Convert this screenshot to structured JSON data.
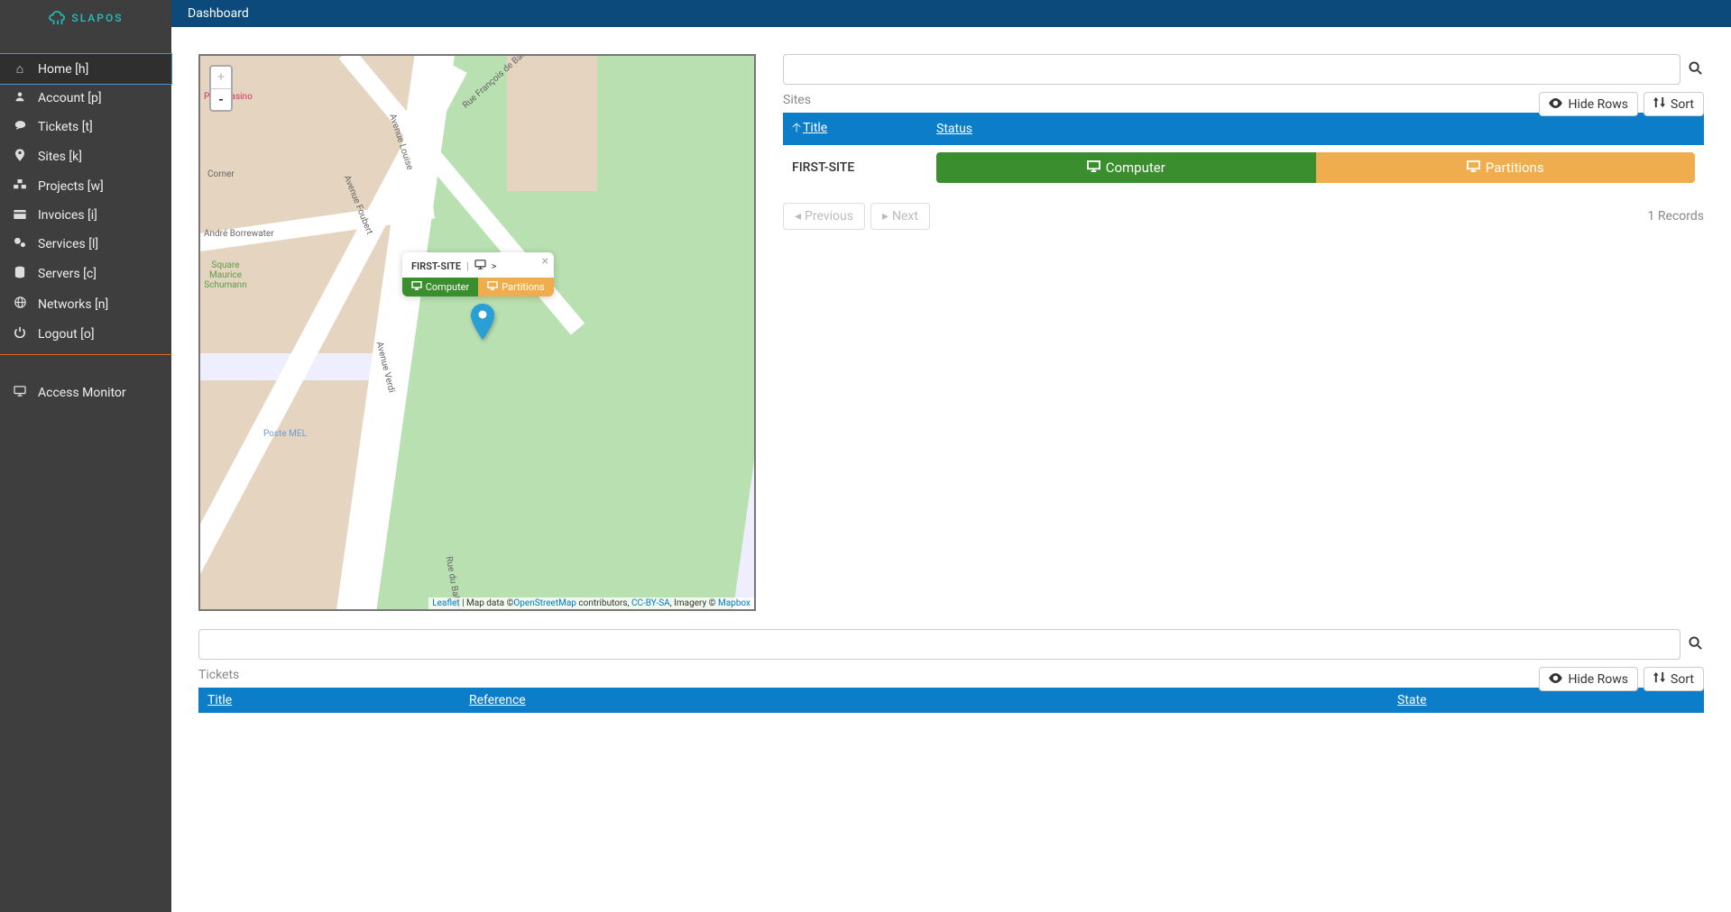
{
  "brand": "SLAPOS",
  "topbar": {
    "title": "Dashboard"
  },
  "sidebar": {
    "items": [
      {
        "icon": "home",
        "label": "Home [h]",
        "active": true
      },
      {
        "icon": "user",
        "label": "Account [p]"
      },
      {
        "icon": "chat",
        "label": "Tickets [t]"
      },
      {
        "icon": "pin",
        "label": "Sites [k]"
      },
      {
        "icon": "cubes",
        "label": "Projects [w]"
      },
      {
        "icon": "card",
        "label": "Invoices [i]"
      },
      {
        "icon": "cogs",
        "label": "Services [l]"
      },
      {
        "icon": "db",
        "label": "Servers [c]"
      },
      {
        "icon": "globe",
        "label": "Networks [n]"
      },
      {
        "icon": "power",
        "label": "Logout [o]"
      }
    ],
    "secondary": [
      {
        "icon": "desktop",
        "label": "Access Monitor"
      }
    ]
  },
  "map": {
    "popup": {
      "title": "FIRST-SITE",
      "computer": "Computer",
      "partitions": "Partitions"
    },
    "zoom_in": "+",
    "zoom_out": "-",
    "streets": [
      "Rue François de Badts",
      "Avenue Louise",
      "Avenue Foubert",
      "Avenue Verdi",
      "André Borrewater",
      "Rue du Ballon",
      "Square Maurice Schumann",
      "Petit Casino",
      "Corner",
      "Poste MEL"
    ],
    "attribution": {
      "leaflet": "Leaflet",
      "sep": " | Map data ©",
      "osm": "OpenStreetMap",
      "contrib": " contributors, ",
      "cc": "CC-BY-SA",
      "imagery": ", Imagery © ",
      "mapbox": "Mapbox"
    }
  },
  "sites": {
    "label": "Sites",
    "hide_rows": "Hide Rows",
    "sort": "Sort",
    "col_title": "Title",
    "col_status": "Status",
    "rows": [
      {
        "title": "FIRST-SITE",
        "computer": "Computer",
        "partitions": "Partitions"
      }
    ],
    "prev": "Previous",
    "next": "Next",
    "records": "1 Records"
  },
  "tickets": {
    "label": "Tickets",
    "hide_rows": "Hide Rows",
    "sort": "Sort",
    "col_title": "Title",
    "col_reference": "Reference",
    "col_state": "State"
  }
}
